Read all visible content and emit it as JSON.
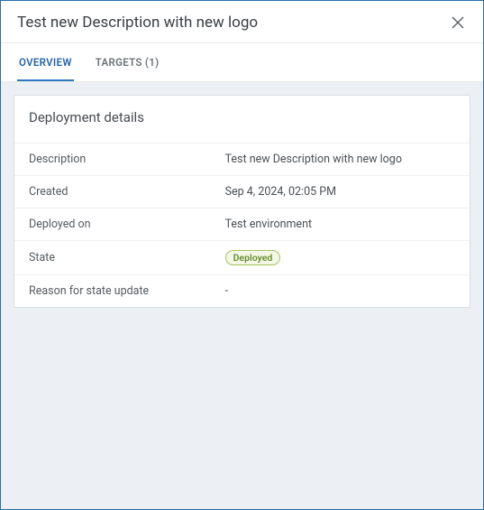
{
  "header": {
    "title": "Test new Description with new logo"
  },
  "tabs": {
    "overview": "OVERVIEW",
    "targets": "TARGETS (1)"
  },
  "card": {
    "title": "Deployment details",
    "rows": {
      "description": {
        "label": "Description",
        "value": "Test new Description with new logo"
      },
      "created": {
        "label": "Created",
        "value": "Sep 4, 2024, 02:05 PM"
      },
      "deployed_on": {
        "label": "Deployed on",
        "value": "Test environment"
      },
      "state": {
        "label": "State",
        "badge": "Deployed"
      },
      "reason": {
        "label": "Reason for state update",
        "value": "-"
      }
    }
  }
}
